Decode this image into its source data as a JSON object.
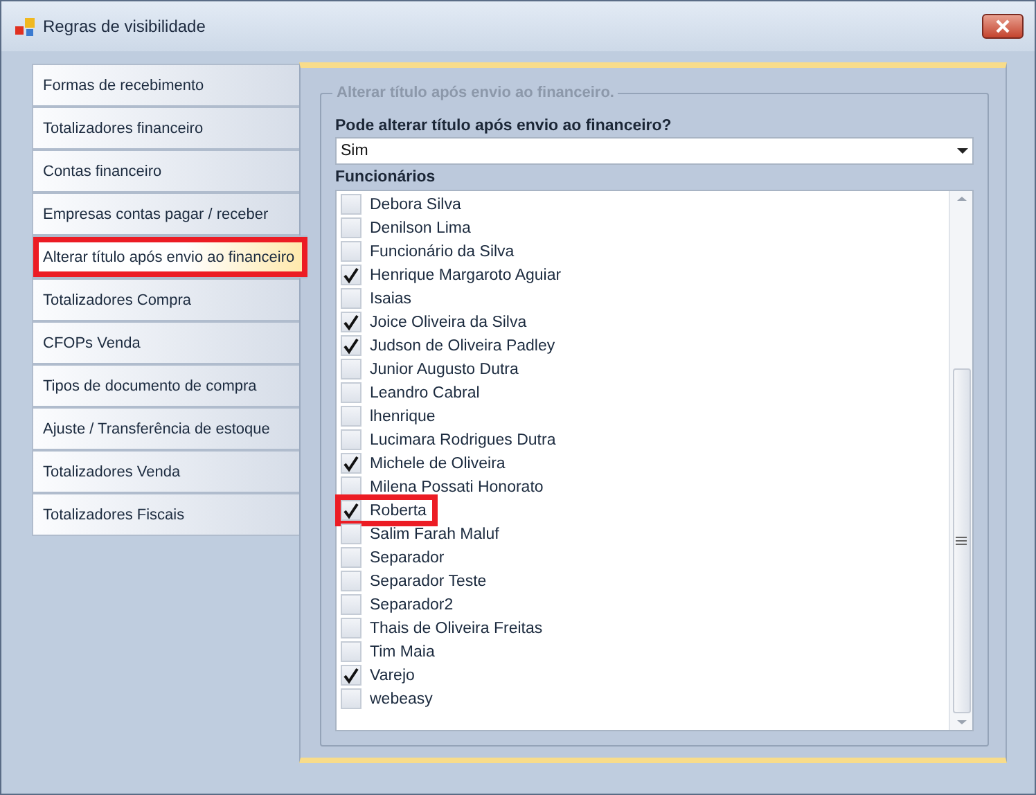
{
  "window": {
    "title": "Regras de visibilidade"
  },
  "nav_items": [
    {
      "label": "Formas de recebimento",
      "selected": false,
      "highlighted": false
    },
    {
      "label": "Totalizadores financeiro",
      "selected": false,
      "highlighted": false
    },
    {
      "label": "Contas financeiro",
      "selected": false,
      "highlighted": false
    },
    {
      "label": "Empresas contas pagar / receber",
      "selected": false,
      "highlighted": false
    },
    {
      "label": "Alterar título após envio ao financeiro",
      "selected": true,
      "highlighted": true
    },
    {
      "label": "Totalizadores Compra",
      "selected": false,
      "highlighted": false
    },
    {
      "label": "CFOPs Venda",
      "selected": false,
      "highlighted": false
    },
    {
      "label": "Tipos de documento de compra",
      "selected": false,
      "highlighted": false
    },
    {
      "label": "Ajuste / Transferência de estoque",
      "selected": false,
      "highlighted": false
    },
    {
      "label": "Totalizadores Venda",
      "selected": false,
      "highlighted": false
    },
    {
      "label": "Totalizadores Fiscais",
      "selected": false,
      "highlighted": false
    }
  ],
  "group": {
    "title": "Alterar título após envio ao financeiro.",
    "question": "Pode alterar título após envio ao financeiro?",
    "answer": "Sim",
    "list_label": "Funcionários"
  },
  "employees": [
    {
      "name": "Debora Silva",
      "checked": false,
      "highlighted": false
    },
    {
      "name": "Denilson Lima",
      "checked": false,
      "highlighted": false
    },
    {
      "name": "Funcionário da Silva",
      "checked": false,
      "highlighted": false
    },
    {
      "name": "Henrique Margaroto Aguiar",
      "checked": true,
      "highlighted": false
    },
    {
      "name": "Isaias",
      "checked": false,
      "highlighted": false
    },
    {
      "name": "Joice Oliveira da Silva",
      "checked": true,
      "highlighted": false
    },
    {
      "name": "Judson de Oliveira Padley",
      "checked": true,
      "highlighted": false
    },
    {
      "name": "Junior Augusto Dutra",
      "checked": false,
      "highlighted": false
    },
    {
      "name": "Leandro Cabral",
      "checked": false,
      "highlighted": false
    },
    {
      "name": "lhenrique",
      "checked": false,
      "highlighted": false
    },
    {
      "name": "Lucimara Rodrigues Dutra",
      "checked": false,
      "highlighted": false
    },
    {
      "name": "Michele de Oliveira",
      "checked": true,
      "highlighted": false
    },
    {
      "name": "Milena Possati Honorato",
      "checked": false,
      "highlighted": false
    },
    {
      "name": "Roberta",
      "checked": true,
      "highlighted": true
    },
    {
      "name": "Salim Farah Maluf",
      "checked": false,
      "highlighted": false
    },
    {
      "name": "Separador",
      "checked": false,
      "highlighted": false
    },
    {
      "name": "Separador Teste",
      "checked": false,
      "highlighted": false
    },
    {
      "name": "Separador2",
      "checked": false,
      "highlighted": false
    },
    {
      "name": "Thais de Oliveira Freitas",
      "checked": false,
      "highlighted": false
    },
    {
      "name": "Tim Maia",
      "checked": false,
      "highlighted": false
    },
    {
      "name": "Varejo",
      "checked": true,
      "highlighted": false
    },
    {
      "name": "webeasy",
      "checked": false,
      "highlighted": false
    }
  ]
}
